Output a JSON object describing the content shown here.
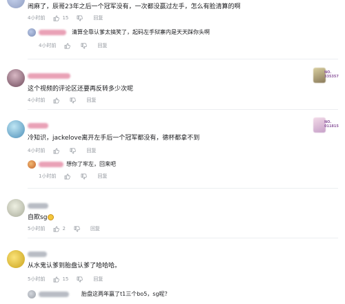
{
  "comments": [
    {
      "text": "闹麻了，辰哥23年之后一个冠军没有，一次都没赢过左手，怎么有脸清算的啊",
      "time": "4小时前",
      "likes": "15",
      "reply": "回复",
      "sub": {
        "text": "清算全靠认爹太搞笑了，起码左手狱寨内是天天踩你头啊",
        "time": "4小时前",
        "reply": "回复"
      }
    },
    {
      "text": "这个视频的评论区还要再反转多少次呢",
      "time": "4小时前",
      "likes": "",
      "reply": "回复",
      "badge": "NO.\n335357"
    },
    {
      "text": "冷知识，jackelove离开左手后一个冠军都没有，德杯都拿不到",
      "time": "4小时前",
      "likes": "",
      "reply": "回复",
      "badge": "NO.\n011815",
      "sub": {
        "text": "想你了牢左，回来吧",
        "time": "1小时前",
        "reply": "回复"
      }
    },
    {
      "text": "自欺sg",
      "time": "5小时前",
      "likes": "2",
      "reply": "回复"
    },
    {
      "text": "从水鬼认爹到胎盘认爹了哈哈哈。",
      "time": "5小时前",
      "likes": "15",
      "reply": "回复",
      "sub": {
        "text": "胎盘这两年赢了t1三个bo5，sg呢？",
        "time": "",
        "reply": ""
      }
    }
  ],
  "colors": {
    "text": "#18191c",
    "meta": "#9499a0",
    "divider": "#eceef1",
    "badge": "#8e5a9e",
    "username": "#e9a1b6"
  },
  "icons": [
    "thumb-up-icon",
    "thumb-down-icon"
  ]
}
